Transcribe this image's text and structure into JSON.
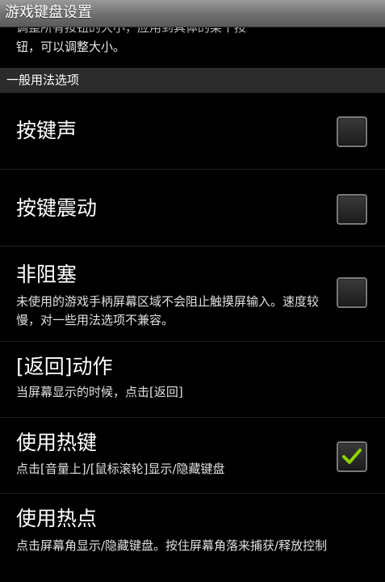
{
  "app": {
    "title": "游戏键盘设置"
  },
  "top_description": {
    "line1": "调整所有按钮的大小，应用到具体的某个按",
    "line2": "钮，可以调整大小。"
  },
  "section": {
    "title": "一般用法选项"
  },
  "preferences": [
    {
      "title": "按键声",
      "summary": "",
      "checked": false
    },
    {
      "title": "按键震动",
      "summary": "",
      "checked": false
    },
    {
      "title": "非阻塞",
      "summary": "未使用的游戏手柄屏幕区域不会阻止触摸屏输入。速度较慢，对一些用法选项不兼容。",
      "checked": false
    },
    {
      "title": "[返回]动作",
      "summary": "当屏幕显示的时候，点击[返回]"
    },
    {
      "title": "使用热键",
      "summary": "点击[音量上]/[鼠标滚轮]显示/隐藏键盘",
      "checked": true
    },
    {
      "title": "使用热点",
      "summary": "点击屏幕角显示/隐藏键盘。按住屏幕角落来捕获/释放控制"
    }
  ],
  "colors": {
    "background": "#000000",
    "titlebar": "#7a7a7a",
    "section_header": "#2b2b2b",
    "check_accent": "#8fd400"
  },
  "icons": {
    "checkmark": "checkmark-icon"
  }
}
